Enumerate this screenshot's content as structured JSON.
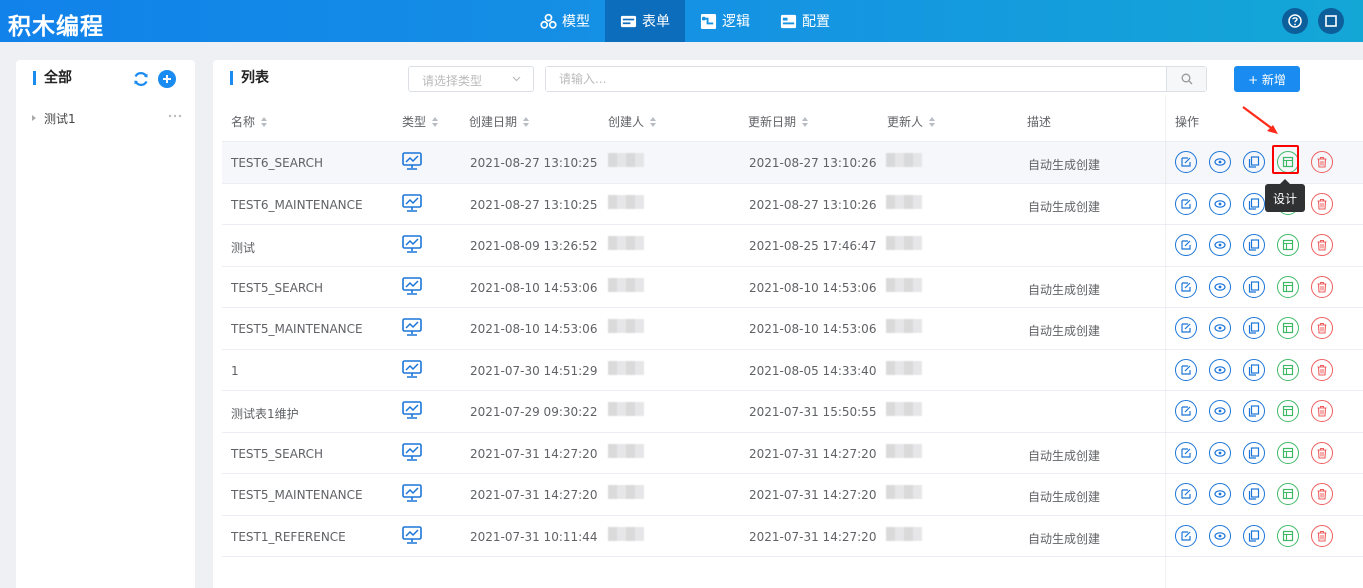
{
  "header": {
    "brand": "积木编程",
    "nav": [
      {
        "label": "模型",
        "icon": "model-icon",
        "active": false
      },
      {
        "label": "表单",
        "icon": "form-icon",
        "active": true
      },
      {
        "label": "逻辑",
        "icon": "logic-icon",
        "active": false
      },
      {
        "label": "配置",
        "icon": "config-icon",
        "active": false
      }
    ]
  },
  "left_panel": {
    "title": "全部",
    "tree": [
      {
        "label": "测试1"
      }
    ]
  },
  "main_panel": {
    "title": "列表",
    "type_select_placeholder": "请选择类型",
    "search_placeholder": "请输入...",
    "add_button": "+ 新增",
    "columns": [
      "名称",
      "类型",
      "创建日期",
      "创建人",
      "更新日期",
      "更新人",
      "描述",
      "操作"
    ],
    "rows": [
      {
        "name": "TEST6_SEARCH",
        "created": "2021-08-27 13:10:25",
        "updated": "2021-08-27 13:10:26",
        "desc": "自动生成创建"
      },
      {
        "name": "TEST6_MAINTENANCE",
        "created": "2021-08-27 13:10:25",
        "updated": "2021-08-27 13:10:26",
        "desc": "自动生成创建"
      },
      {
        "name": "测试",
        "created": "2021-08-09 13:26:52",
        "updated": "2021-08-25 17:46:47",
        "desc": ""
      },
      {
        "name": "TEST5_SEARCH",
        "created": "2021-08-10 14:53:06",
        "updated": "2021-08-10 14:53:06",
        "desc": "自动生成创建"
      },
      {
        "name": "TEST5_MAINTENANCE",
        "created": "2021-08-10 14:53:06",
        "updated": "2021-08-10 14:53:06",
        "desc": "自动生成创建"
      },
      {
        "name": "1",
        "created": "2021-07-30 14:51:29",
        "updated": "2021-08-05 14:33:40",
        "desc": ""
      },
      {
        "name": "测试表1维护",
        "created": "2021-07-29 09:30:22",
        "updated": "2021-07-31 15:50:55",
        "desc": ""
      },
      {
        "name": "TEST5_SEARCH",
        "created": "2021-07-31 14:27:20",
        "updated": "2021-07-31 14:27:20",
        "desc": "自动生成创建"
      },
      {
        "name": "TEST5_MAINTENANCE",
        "created": "2021-07-31 14:27:20",
        "updated": "2021-07-31 14:27:20",
        "desc": "自动生成创建"
      },
      {
        "name": "TEST1_REFERENCE",
        "created": "2021-07-31 10:11:44",
        "updated": "2021-07-31 14:27:20",
        "desc": "自动生成创建"
      }
    ],
    "operations": [
      "edit-icon",
      "view-icon",
      "copy-icon",
      "design-icon",
      "delete-icon"
    ],
    "tooltip": "设计"
  },
  "colors": {
    "header_start": "#1182ea",
    "header_end": "#13a7d6",
    "nav_active": "#0c6dbd",
    "accent": "#1a8bf0",
    "op_blue": "#1b75d8",
    "op_green": "#3fb866",
    "op_red": "#ee5e5e",
    "annotation": "#ff0000"
  }
}
